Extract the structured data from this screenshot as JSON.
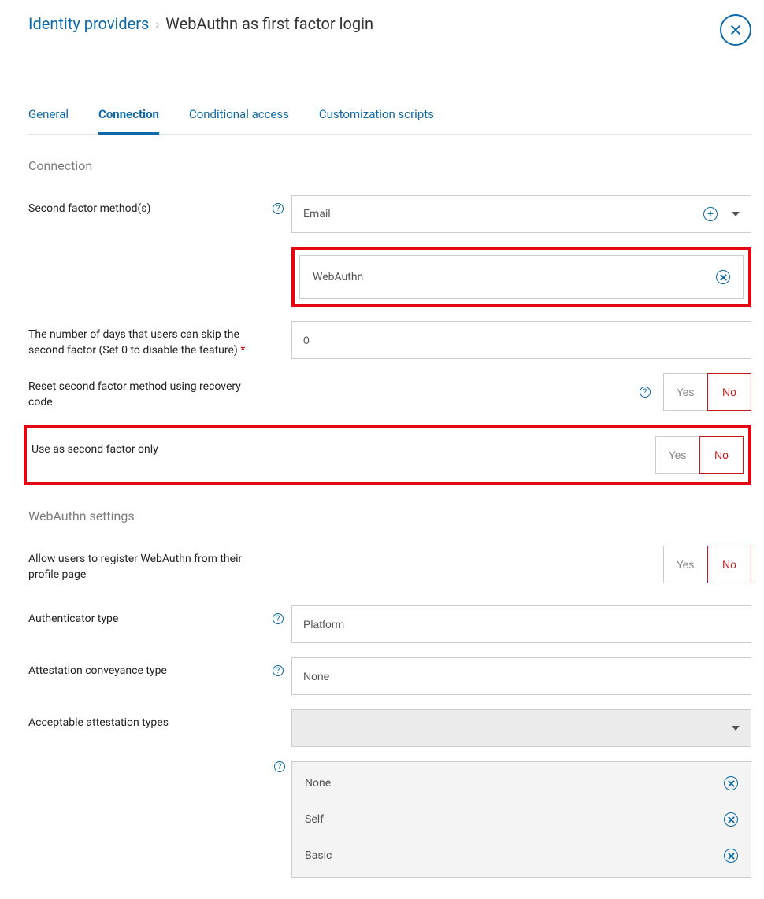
{
  "breadcrumb": {
    "parent": "Identity providers",
    "current": "WebAuthn as first factor login"
  },
  "tabs": [
    "General",
    "Connection",
    "Conditional access",
    "Customization scripts"
  ],
  "activeTab": 1,
  "section1": {
    "title": "Connection"
  },
  "secondFactor": {
    "label": "Second factor method(s)",
    "value": "Email",
    "chip": "WebAuthn"
  },
  "skipDays": {
    "label": "The number of days that users can skip the second factor (Set 0 to disable the feature)",
    "value": "0"
  },
  "resetRecovery": {
    "label": "Reset second factor method using recovery code",
    "yes": "Yes",
    "no": "No",
    "selected": "No"
  },
  "useSecondOnly": {
    "label": "Use as second factor only",
    "yes": "Yes",
    "no": "No",
    "selected": "No"
  },
  "section2": {
    "title": "WebAuthn settings"
  },
  "allowRegister": {
    "label": "Allow users to register WebAuthn from their profile page",
    "yes": "Yes",
    "no": "No",
    "selected": "No"
  },
  "authType": {
    "label": "Authenticator type",
    "value": "Platform"
  },
  "attConvey": {
    "label": "Attestation conveyance type",
    "value": "None"
  },
  "attTypes": {
    "label": "Acceptable attestation types",
    "value": "",
    "items": [
      "None",
      "Self",
      "Basic"
    ]
  }
}
